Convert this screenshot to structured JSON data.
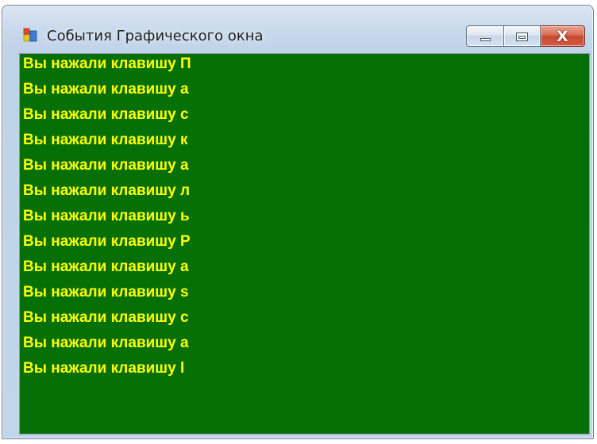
{
  "window": {
    "title": "События Графического окна",
    "icon": "winforms-app-icon",
    "caption_buttons": [
      {
        "name": "minimize",
        "icon": "minimize-icon"
      },
      {
        "name": "maximize",
        "icon": "maximize-icon"
      },
      {
        "name": "close",
        "icon": "close-icon",
        "glyph": "X"
      }
    ]
  },
  "colors": {
    "client_background": "#067006",
    "text": "#ffff00",
    "close_button": "#c74a2f"
  },
  "messages": [
    "Вы нажали клавишу П",
    "Вы нажали клавишу а",
    "Вы нажали клавишу с",
    "Вы нажали клавишу к",
    "Вы нажали клавишу а",
    "Вы нажали клавишу л",
    "Вы нажали клавишу ь",
    "Вы нажали клавишу Р",
    "Вы нажали клавишу а",
    "Вы нажали клавишу s",
    "Вы нажали клавишу с",
    "Вы нажали клавишу а",
    "Вы нажали клавишу l"
  ]
}
